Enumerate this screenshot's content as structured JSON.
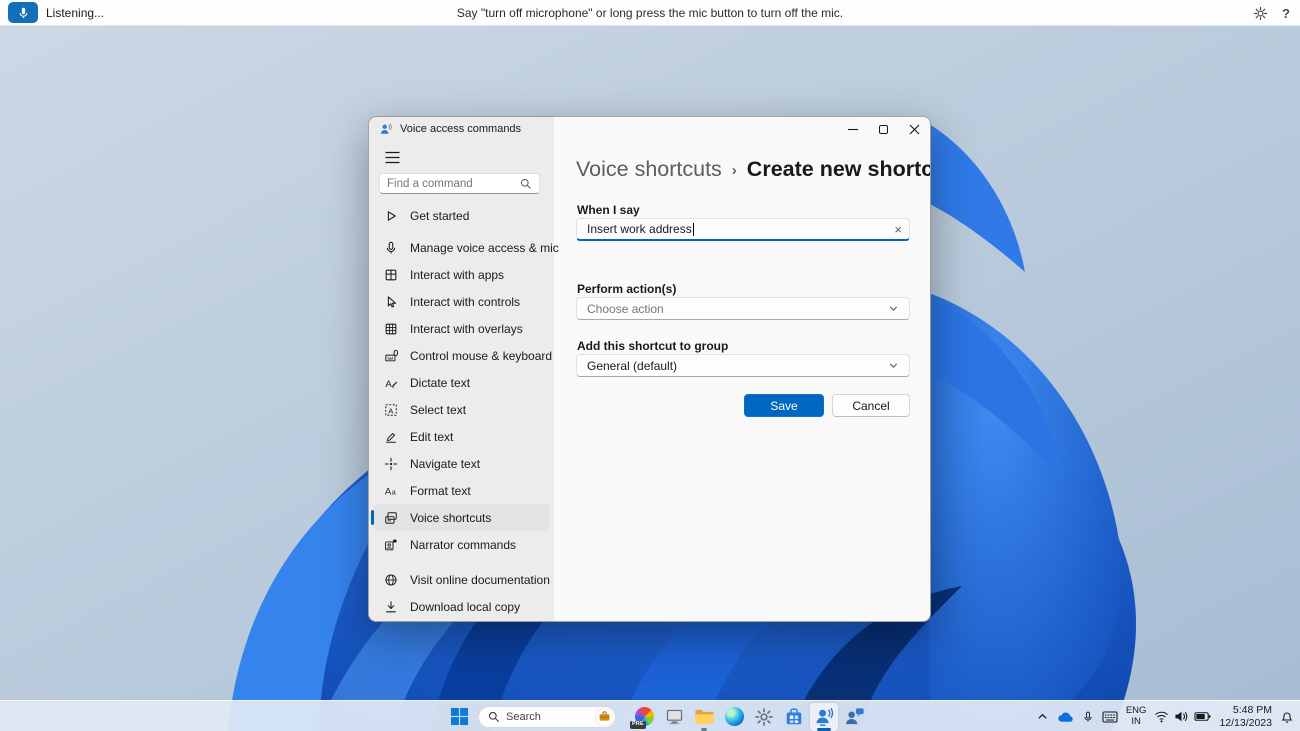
{
  "colors": {
    "accent": "#0067c0",
    "mic_button": "#1270b8",
    "taskbar_active_underline": "#0067c0"
  },
  "voice_bar": {
    "status": "Listening...",
    "hint": "Say \"turn off microphone\" or long press the mic button to turn off the mic.",
    "help_label": "?"
  },
  "window": {
    "title": "Voice access commands",
    "sidebar": {
      "search_placeholder": "Find a command",
      "items": [
        {
          "label": "Get started",
          "icon": "play-icon"
        },
        {
          "label": "Manage voice access & mic",
          "icon": "microphone-icon"
        },
        {
          "label": "Interact with apps",
          "icon": "apps-icon"
        },
        {
          "label": "Interact with controls",
          "icon": "cursor-icon"
        },
        {
          "label": "Interact with overlays",
          "icon": "grid-overlay-icon"
        },
        {
          "label": "Control mouse & keyboard",
          "icon": "mouse-keyboard-icon"
        },
        {
          "label": "Dictate text",
          "icon": "dictate-icon"
        },
        {
          "label": "Select text",
          "icon": "select-text-icon"
        },
        {
          "label": "Edit text",
          "icon": "edit-text-icon"
        },
        {
          "label": "Navigate text",
          "icon": "navigate-text-icon"
        },
        {
          "label": "Format text",
          "icon": "format-text-icon"
        },
        {
          "label": "Voice shortcuts",
          "icon": "voice-shortcuts-icon",
          "selected": true
        },
        {
          "label": "Narrator commands",
          "icon": "narrator-icon"
        }
      ],
      "footer_items": [
        {
          "label": "Visit online documentation",
          "icon": "globe-icon"
        },
        {
          "label": "Download local copy",
          "icon": "download-icon"
        }
      ]
    },
    "main": {
      "breadcrumb": {
        "parent": "Voice shortcuts",
        "separator": "›",
        "current": "Create new shortcut"
      },
      "fields": {
        "when_i_say": {
          "label": "When I say",
          "value": "Insert work address"
        },
        "perform_action": {
          "label": "Perform action(s)",
          "value": "Choose action"
        },
        "group": {
          "label": "Add this shortcut to group",
          "value": "General (default)"
        }
      },
      "buttons": {
        "save": "Save",
        "cancel": "Cancel"
      }
    }
  },
  "taskbar": {
    "search_placeholder": "Search",
    "apps": [
      {
        "icon": "preview-app-icon",
        "badge": "PRE"
      },
      {
        "icon": "device-icon"
      },
      {
        "icon": "file-explorer-icon",
        "open": true
      },
      {
        "icon": "edge-icon"
      },
      {
        "icon": "settings-gear-icon"
      },
      {
        "icon": "store-icon"
      },
      {
        "icon": "voice-access-icon",
        "active": true
      },
      {
        "icon": "feedback-icon"
      }
    ],
    "tray": {
      "language_line1": "ENG",
      "language_line2": "IN",
      "time": "5:48 PM",
      "date": "12/13/2023"
    }
  }
}
